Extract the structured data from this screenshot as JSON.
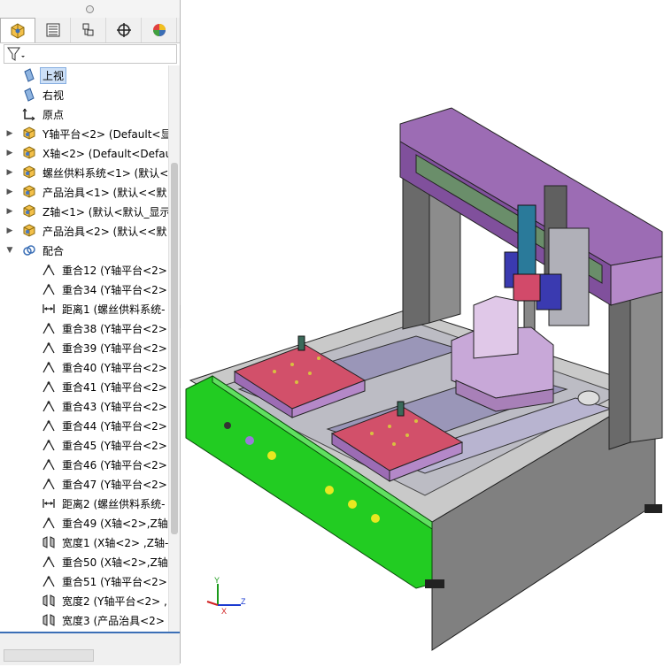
{
  "tree": {
    "items": [
      {
        "label": "上视",
        "icon": "plane-icon",
        "selected": true
      },
      {
        "label": "右视",
        "icon": "plane-icon"
      },
      {
        "label": "原点",
        "icon": "origin-icon"
      },
      {
        "label": "Y轴平台<2> (Default<显",
        "icon": "assembly-icon",
        "expand": "▶"
      },
      {
        "label": "X轴<2> (Default<Defau",
        "icon": "assembly-icon",
        "expand": "▶"
      },
      {
        "label": "螺丝供料系统<1> (默认<<",
        "icon": "assembly-icon",
        "expand": "▶"
      },
      {
        "label": "产品治具<1> (默认<<默",
        "icon": "assembly-icon",
        "expand": "▶"
      },
      {
        "label": "Z轴<1> (默认<默认_显示",
        "icon": "assembly-icon",
        "expand": "▶"
      },
      {
        "label": "产品治具<2> (默认<<默",
        "icon": "assembly-icon",
        "expand": "▶"
      },
      {
        "label": "配合",
        "icon": "mates-folder-icon",
        "expand": "▼"
      },
      {
        "label": "重合12 (Y轴平台<2>",
        "icon": "coincident-icon",
        "child": true
      },
      {
        "label": "重合34 (Y轴平台<2>",
        "icon": "coincident-icon",
        "child": true
      },
      {
        "label": "距离1 (螺丝供料系统-",
        "icon": "distance-icon",
        "child": true
      },
      {
        "label": "重合38 (Y轴平台<2>",
        "icon": "coincident-icon",
        "child": true
      },
      {
        "label": "重合39 (Y轴平台<2>",
        "icon": "coincident-icon",
        "child": true
      },
      {
        "label": "重合40 (Y轴平台<2>",
        "icon": "coincident-icon",
        "child": true
      },
      {
        "label": "重合41 (Y轴平台<2>",
        "icon": "coincident-icon",
        "child": true
      },
      {
        "label": "重合43 (Y轴平台<2>",
        "icon": "coincident-icon",
        "child": true
      },
      {
        "label": "重合44 (Y轴平台<2>",
        "icon": "coincident-icon",
        "child": true
      },
      {
        "label": "重合45 (Y轴平台<2>",
        "icon": "coincident-icon",
        "child": true
      },
      {
        "label": "重合46 (Y轴平台<2>",
        "icon": "coincident-icon",
        "child": true
      },
      {
        "label": "重合47 (Y轴平台<2>",
        "icon": "coincident-icon",
        "child": true
      },
      {
        "label": "距离2 (螺丝供料系统-",
        "icon": "distance-icon",
        "child": true
      },
      {
        "label": "重合49 (X轴<2>,Z轴",
        "icon": "coincident-icon",
        "child": true
      },
      {
        "label": "宽度1 (X轴<2> ,Z轴-",
        "icon": "width-icon",
        "child": true
      },
      {
        "label": "重合50 (X轴<2>,Z轴",
        "icon": "coincident-icon",
        "child": true
      },
      {
        "label": "重合51 (Y轴平台<2>",
        "icon": "coincident-icon",
        "child": true
      },
      {
        "label": "宽度2 (Y轴平台<2> ,",
        "icon": "width-icon",
        "child": true
      },
      {
        "label": "宽度3 (产品治具<2>",
        "icon": "width-icon",
        "child": true
      }
    ]
  },
  "triad": {
    "y": "Y",
    "x": "X",
    "z": "Z"
  },
  "colors": {
    "frame": "#7f7f7f",
    "gantry": "#9a6ab0",
    "front_panel": "#1fcf1f",
    "fixture": "#d2506a",
    "selection": "#cde0f7"
  }
}
